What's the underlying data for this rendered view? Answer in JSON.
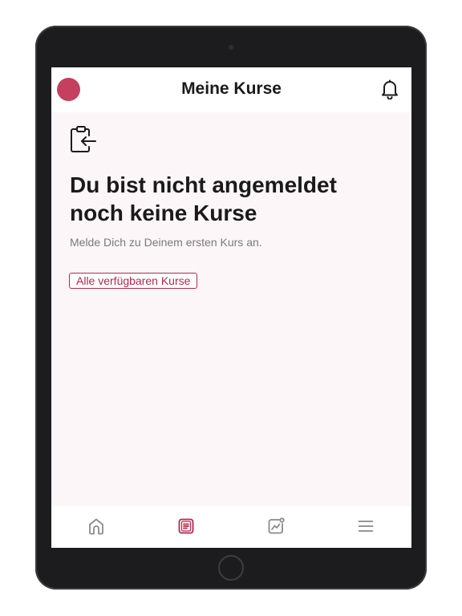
{
  "header": {
    "title": "Meine Kurse",
    "avatar_color": "#c4405e"
  },
  "empty_state": {
    "icon": "clipboard-arrow-icon",
    "headline": "Du bist nicht angemeldet noch keine Kurse",
    "subtext": "Melde Dich zu Deinem ersten Kurs an.",
    "button_label": "Alle verfügbaren Kurse"
  },
  "bottom_nav": {
    "items": [
      {
        "icon": "home-icon",
        "active": false
      },
      {
        "icon": "courses-icon",
        "active": true
      },
      {
        "icon": "progress-chart-icon",
        "active": false
      },
      {
        "icon": "menu-icon",
        "active": false
      }
    ]
  },
  "colors": {
    "accent": "#b5274b",
    "background": "#fdf6f9",
    "inactive_icon": "#8a8a8a"
  }
}
